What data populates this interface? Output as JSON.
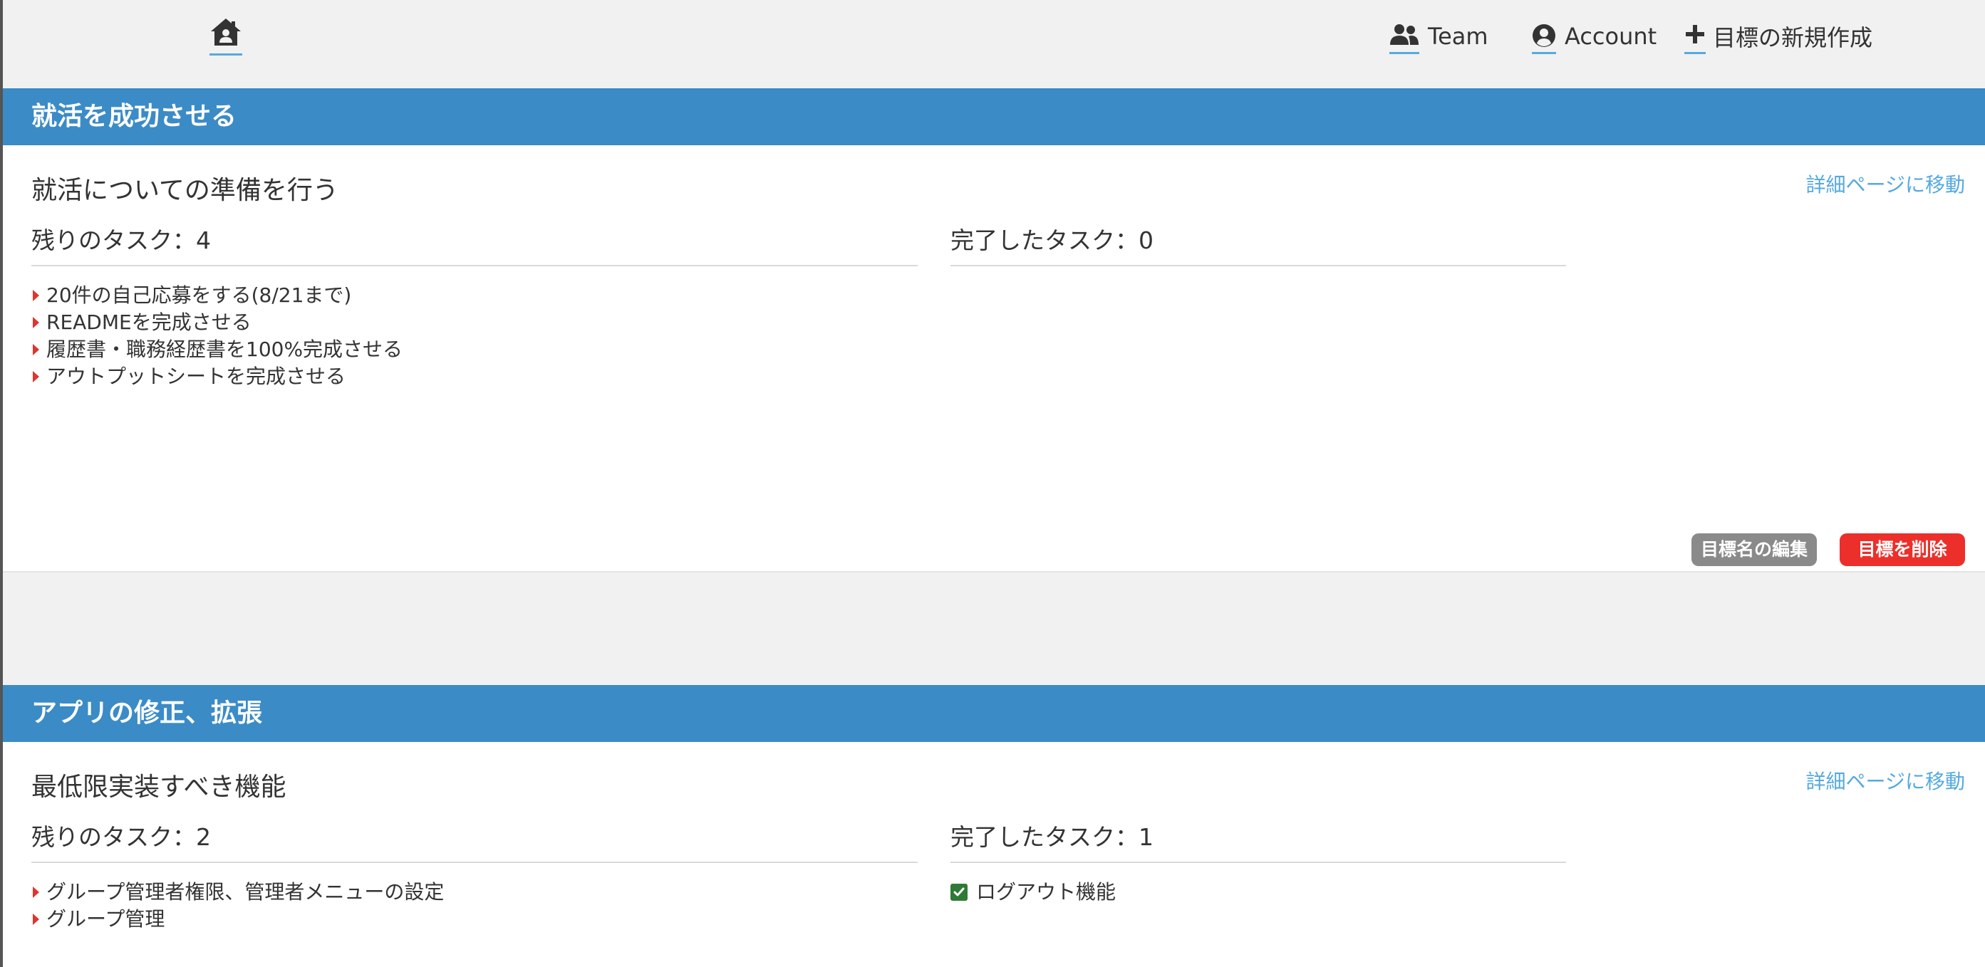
{
  "nav": {
    "home_icon": "house-user-icon",
    "team": {
      "icon": "users-icon",
      "label": "Team"
    },
    "account": {
      "icon": "user-circle-icon",
      "label": "Account"
    },
    "new_goal": {
      "icon": "plus-icon",
      "label": "目標の新規作成"
    }
  },
  "colors": {
    "header_blue": "#3b8bc7",
    "link_blue": "#55a9e0",
    "caret_red": "#e0342d",
    "delete_red": "#ec2f2a",
    "edit_gray": "#8a8a8a",
    "check_green": "#2f7a34"
  },
  "goals": [
    {
      "title": "就活を成功させる",
      "detail_link": "詳細ページに移動",
      "name": "就活についての準備を行う",
      "remaining_label": "残りのタスク：4",
      "done_label": "完了したタスク：0",
      "remaining_tasks": [
        "20件の自己応募をする(8/21まで)",
        "READMEを完成させる",
        "履歴書・職務経歴書を100%完成させる",
        "アウトプットシートを完成させる"
      ],
      "done_tasks": [],
      "edit_button": "目標名の編集",
      "delete_button": "目標を削除"
    },
    {
      "title": "アプリの修正、拡張",
      "detail_link": "詳細ページに移動",
      "name": "最低限実装すべき機能",
      "remaining_label": "残りのタスク：2",
      "done_label": "完了したタスク：1",
      "remaining_tasks": [
        "グループ管理者権限、管理者メニューの設定",
        "グループ管理"
      ],
      "done_tasks": [
        "ログアウト機能"
      ]
    }
  ]
}
